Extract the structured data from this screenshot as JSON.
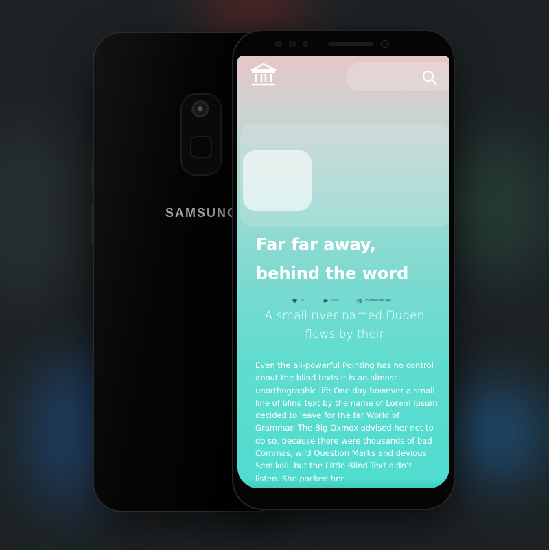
{
  "device": {
    "brand_logo": "SAMSUNG"
  },
  "app": {
    "header": {
      "logo_icon": "bank-columns-icon",
      "search_icon": "search-icon"
    },
    "article": {
      "title": "Far far away, behind the word",
      "meta": {
        "likes": "25",
        "comments": "148",
        "time": "25 minutes ago"
      },
      "subtitle": "A small river named Duden flows by their",
      "body": "Even the all-powerful Pointing has no control about the blind texts it is an almost unorthographic life One day however a small line of blind text by the name of Lorem Ipsum decided to leave for the far World of Grammar. The Big Oxmox advised her not to do so, because there were thousands of bad Commas, wild Question Marks and devious Semikoli, but the Little Blind Text didn’t listen. She packed her"
    }
  },
  "colors": {
    "screen_top": "#e6c6c7",
    "screen_bottom": "#4fdccf",
    "meta_text": "#1d5a58"
  }
}
